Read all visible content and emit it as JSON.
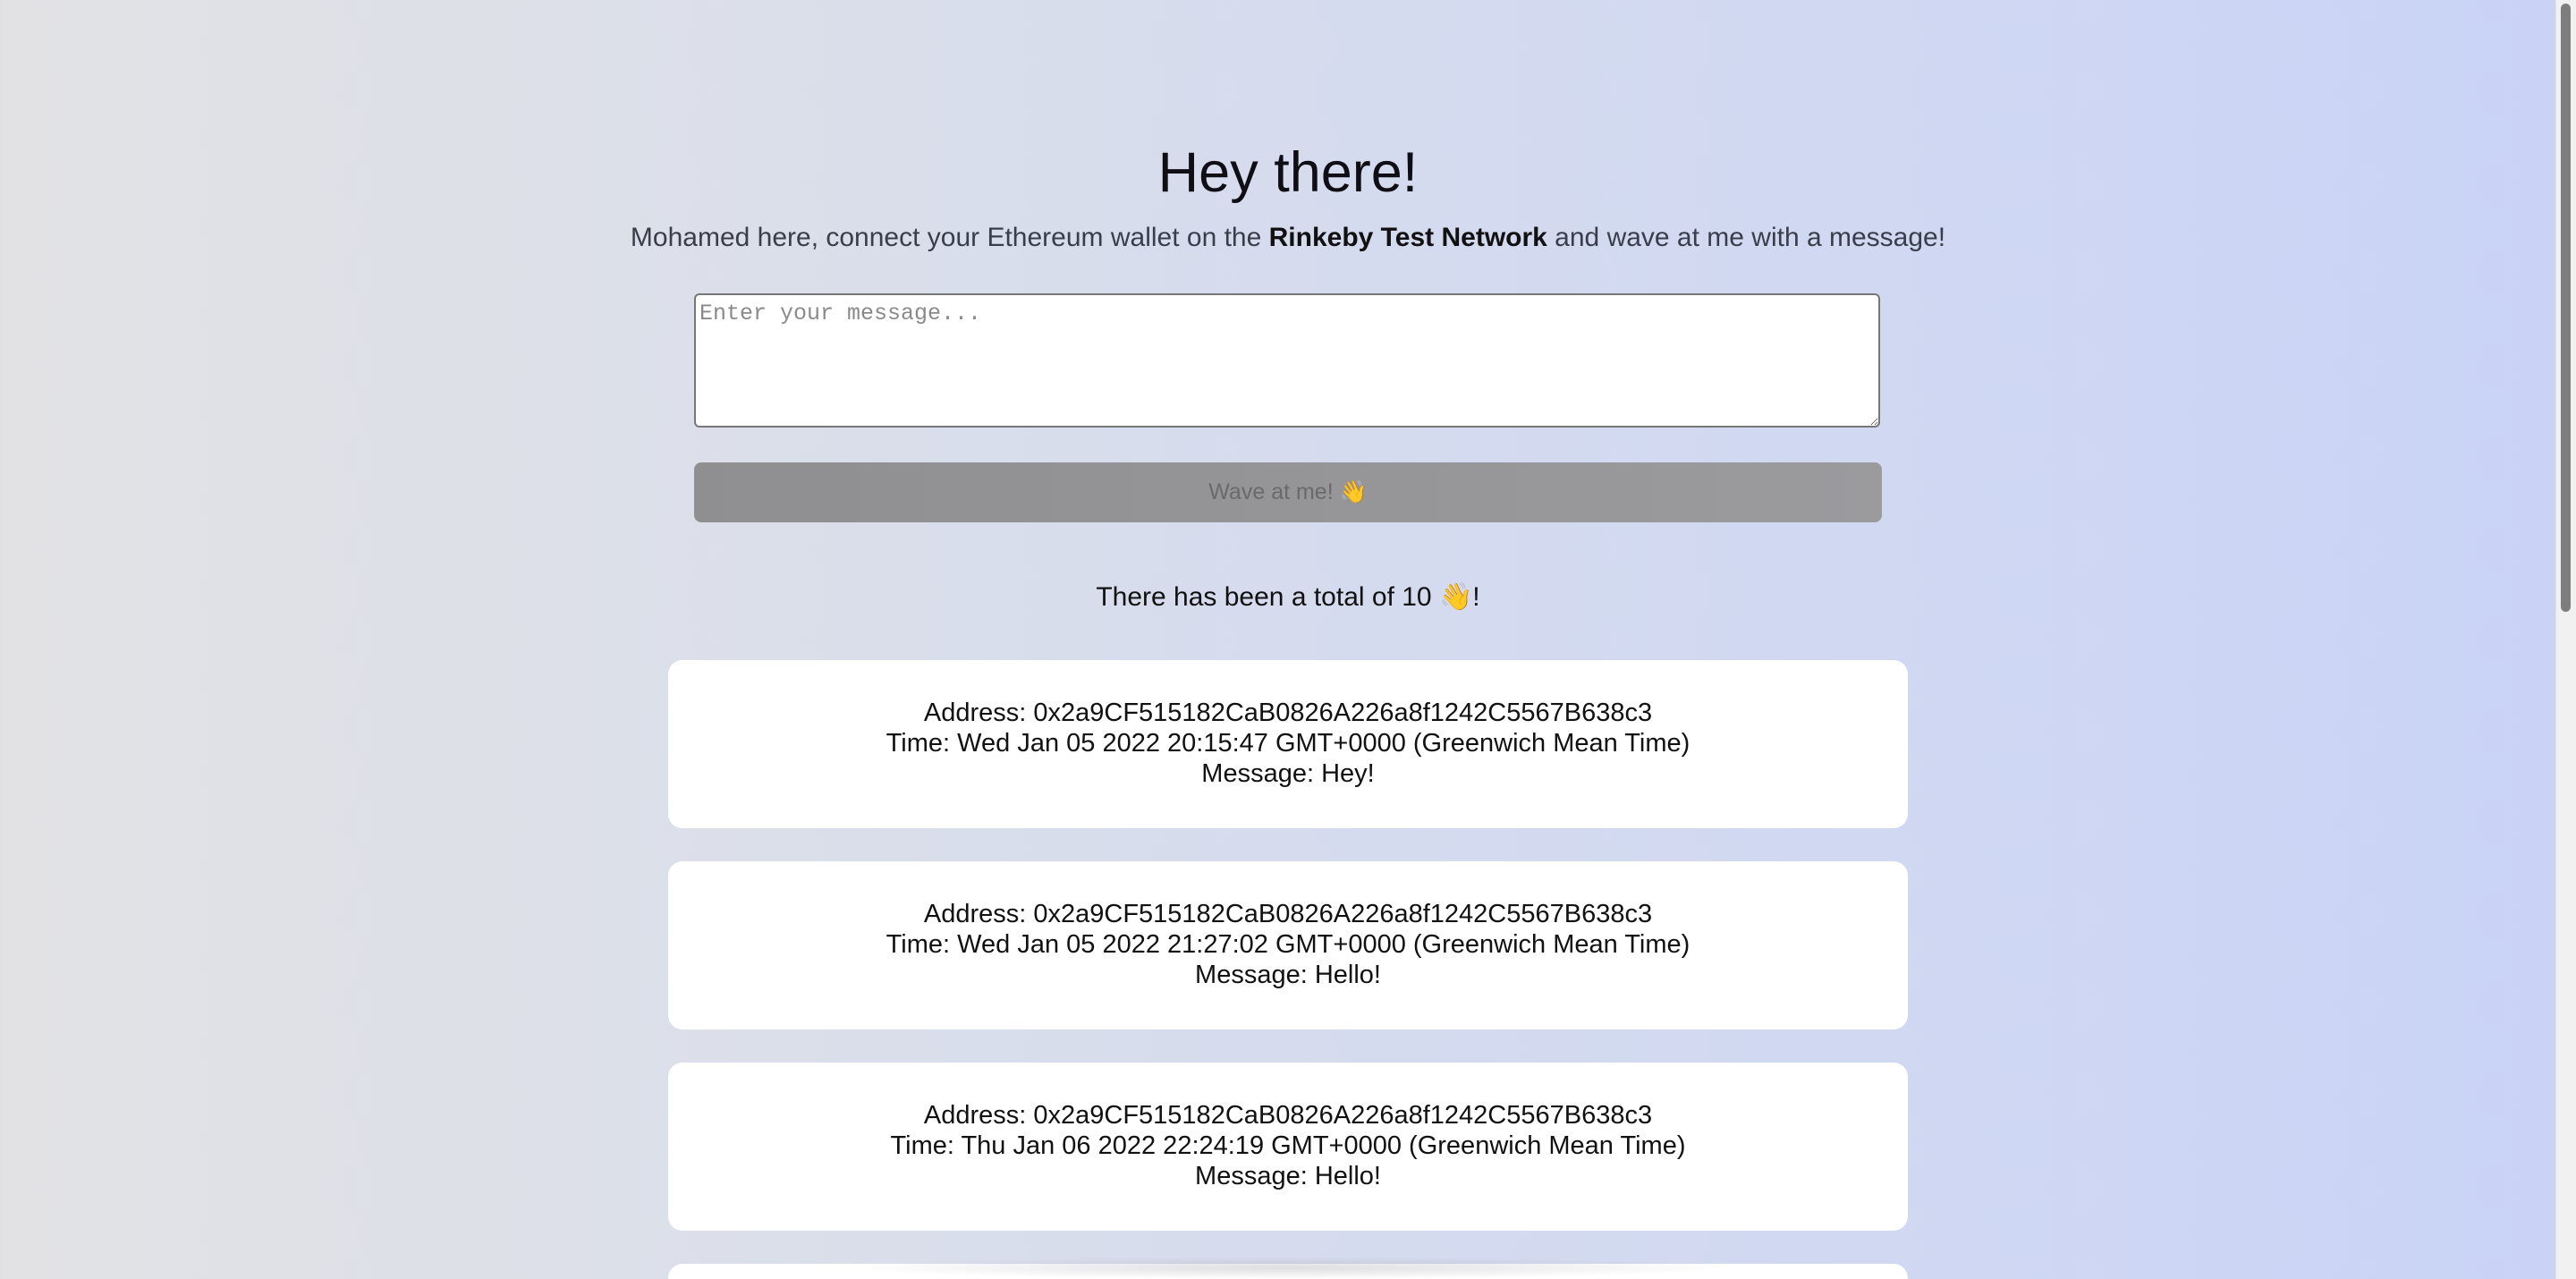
{
  "header": {
    "title": "Hey there!",
    "subtitle_prefix": "Mohamed here, connect your Ethereum wallet on the ",
    "subtitle_bold": "Rinkeby Test Network",
    "subtitle_suffix": " and wave at me with a message!"
  },
  "form": {
    "message_placeholder": "Enter your message...",
    "message_value": "",
    "wave_button_label": "Wave at me! 👋"
  },
  "summary": {
    "total_text": "There has been a total of 10 👋!"
  },
  "waves": [
    {
      "address": "Address: 0x2a9CF515182CaB0826A226a8f1242C5567B638c3",
      "time": "Time: Wed Jan 05 2022 20:15:47 GMT+0000 (Greenwich Mean Time)",
      "message": "Message: Hey!"
    },
    {
      "address": "Address: 0x2a9CF515182CaB0826A226a8f1242C5567B638c3",
      "time": "Time: Wed Jan 05 2022 21:27:02 GMT+0000 (Greenwich Mean Time)",
      "message": "Message: Hello!"
    },
    {
      "address": "Address: 0x2a9CF515182CaB0826A226a8f1242C5567B638c3",
      "time": "Time: Thu Jan 06 2022 22:24:19 GMT+0000 (Greenwich Mean Time)",
      "message": "Message: Hello!"
    }
  ],
  "colors": {
    "background_start": "#e2e2e5",
    "background_end": "#c9d3f6",
    "button_background": "#979799",
    "card_background": "#ffffff"
  }
}
